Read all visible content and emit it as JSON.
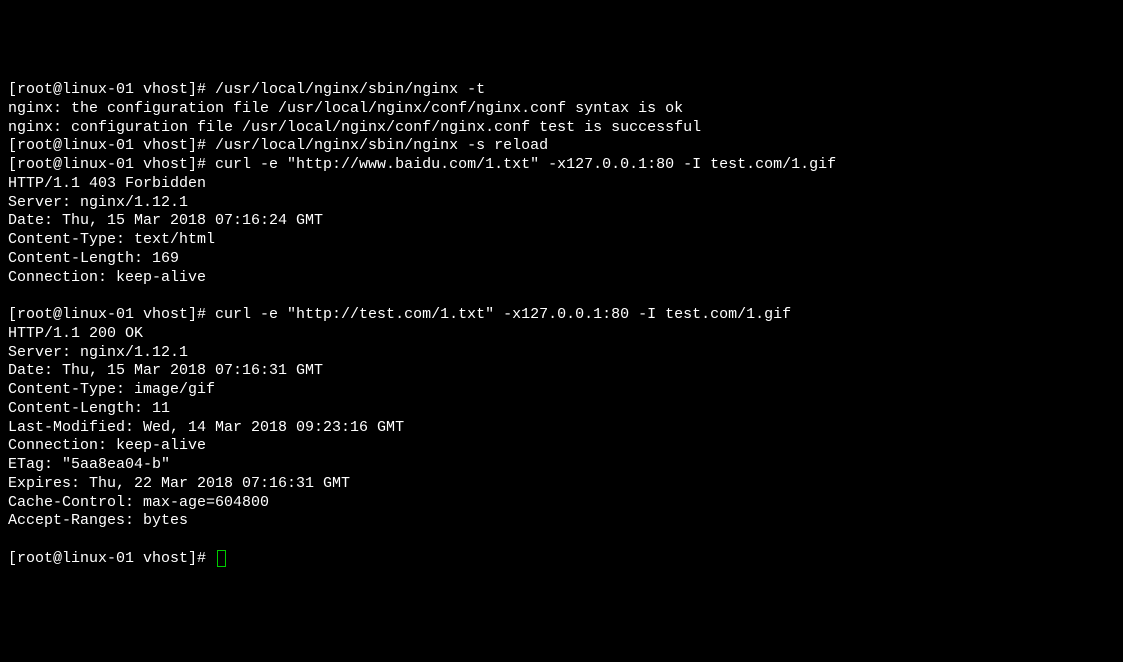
{
  "terminal": {
    "lines": [
      "[root@linux-01 vhost]# /usr/local/nginx/sbin/nginx -t",
      "nginx: the configuration file /usr/local/nginx/conf/nginx.conf syntax is ok",
      "nginx: configuration file /usr/local/nginx/conf/nginx.conf test is successful",
      "[root@linux-01 vhost]# /usr/local/nginx/sbin/nginx -s reload",
      "[root@linux-01 vhost]# curl -e \"http://www.baidu.com/1.txt\" -x127.0.0.1:80 -I test.com/1.gif",
      "HTTP/1.1 403 Forbidden",
      "Server: nginx/1.12.1",
      "Date: Thu, 15 Mar 2018 07:16:24 GMT",
      "Content-Type: text/html",
      "Content-Length: 169",
      "Connection: keep-alive",
      "",
      "[root@linux-01 vhost]# curl -e \"http://test.com/1.txt\" -x127.0.0.1:80 -I test.com/1.gif",
      "HTTP/1.1 200 OK",
      "Server: nginx/1.12.1",
      "Date: Thu, 15 Mar 2018 07:16:31 GMT",
      "Content-Type: image/gif",
      "Content-Length: 11",
      "Last-Modified: Wed, 14 Mar 2018 09:23:16 GMT",
      "Connection: keep-alive",
      "ETag: \"5aa8ea04-b\"",
      "Expires: Thu, 22 Mar 2018 07:16:31 GMT",
      "Cache-Control: max-age=604800",
      "Accept-Ranges: bytes",
      "",
      "[root@linux-01 vhost]# "
    ]
  }
}
